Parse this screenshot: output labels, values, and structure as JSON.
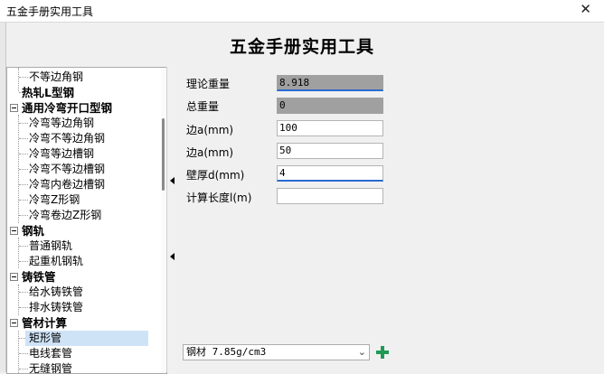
{
  "window": {
    "title": "五金手册实用工具",
    "close_glyph": "✕"
  },
  "header": {
    "title": "五金手册实用工具"
  },
  "tree": {
    "items": [
      {
        "label": "不等边角钢",
        "level": 1,
        "bold": false
      },
      {
        "label": "热轧L型钢",
        "level": 1,
        "bold": true
      },
      {
        "label": "通用冷弯开口型钢",
        "level": 0,
        "bold": true,
        "expander": "−"
      },
      {
        "label": "冷弯等边角钢",
        "level": 1,
        "bold": false
      },
      {
        "label": "冷弯不等边角钢",
        "level": 1,
        "bold": false
      },
      {
        "label": "冷弯等边槽钢",
        "level": 1,
        "bold": false
      },
      {
        "label": "冷弯不等边槽钢",
        "level": 1,
        "bold": false
      },
      {
        "label": "冷弯内卷边槽钢",
        "level": 1,
        "bold": false
      },
      {
        "label": "冷弯Z形钢",
        "level": 1,
        "bold": false
      },
      {
        "label": "冷弯卷边Z形钢",
        "level": 1,
        "bold": false
      },
      {
        "label": "钢轨",
        "level": 0,
        "bold": true,
        "expander": "−"
      },
      {
        "label": "普通钢轨",
        "level": 1,
        "bold": false
      },
      {
        "label": "起重机钢轨",
        "level": 1,
        "bold": false
      },
      {
        "label": "铸铁管",
        "level": 0,
        "bold": true,
        "expander": "−"
      },
      {
        "label": "给水铸铁管",
        "level": 1,
        "bold": false
      },
      {
        "label": "排水铸铁管",
        "level": 1,
        "bold": false
      },
      {
        "label": "管材计算",
        "level": 0,
        "bold": true,
        "expander": "−"
      },
      {
        "label": "矩形管",
        "level": 1,
        "bold": false,
        "selected": true
      },
      {
        "label": "电线套管",
        "level": 1,
        "bold": false
      },
      {
        "label": "无缝钢管",
        "level": 1,
        "bold": false
      }
    ]
  },
  "form": {
    "fields": [
      {
        "label": "理论重量",
        "value": "8.918",
        "readonly": true
      },
      {
        "label": "总重量",
        "value": "0",
        "readonly": true
      },
      {
        "label": "边a(mm)",
        "value": "100",
        "readonly": false
      },
      {
        "label": "边a(mm)",
        "value": "50",
        "readonly": false
      },
      {
        "label": "壁厚d(mm)",
        "value": "4",
        "readonly": false
      },
      {
        "label": "计算长度l(m)",
        "value": "",
        "readonly": false
      }
    ],
    "material": {
      "value": "钢材 7.85g/cm3",
      "chevron": "⌄"
    },
    "add_button": {
      "icon": "plus-icon",
      "color": "#1f9a56"
    }
  }
}
